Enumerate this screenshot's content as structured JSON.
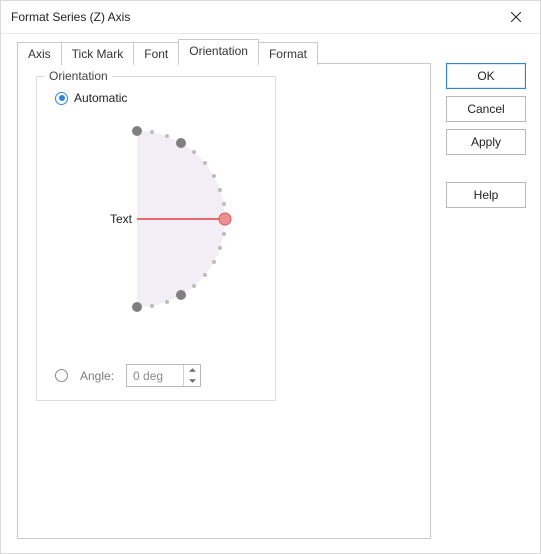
{
  "window": {
    "title": "Format Series (Z) Axis"
  },
  "tabs": {
    "axis": "Axis",
    "tick_mark": "Tick Mark",
    "font": "Font",
    "orientation": "Orientation",
    "format": "Format",
    "active": "orientation"
  },
  "buttons": {
    "ok": "OK",
    "cancel": "Cancel",
    "apply": "Apply",
    "help": "Help"
  },
  "orientation_panel": {
    "group_title": "Orientation",
    "automatic_label": "Automatic",
    "mode": "automatic",
    "dial": {
      "preview_text": "Text",
      "angle_deg": 0
    },
    "angle_label": "Angle:",
    "angle_value": "0 deg",
    "angle_enabled": false
  },
  "icons": {
    "close": "close-icon",
    "spin_up": "chevron-up-icon",
    "spin_down": "chevron-down-icon"
  }
}
